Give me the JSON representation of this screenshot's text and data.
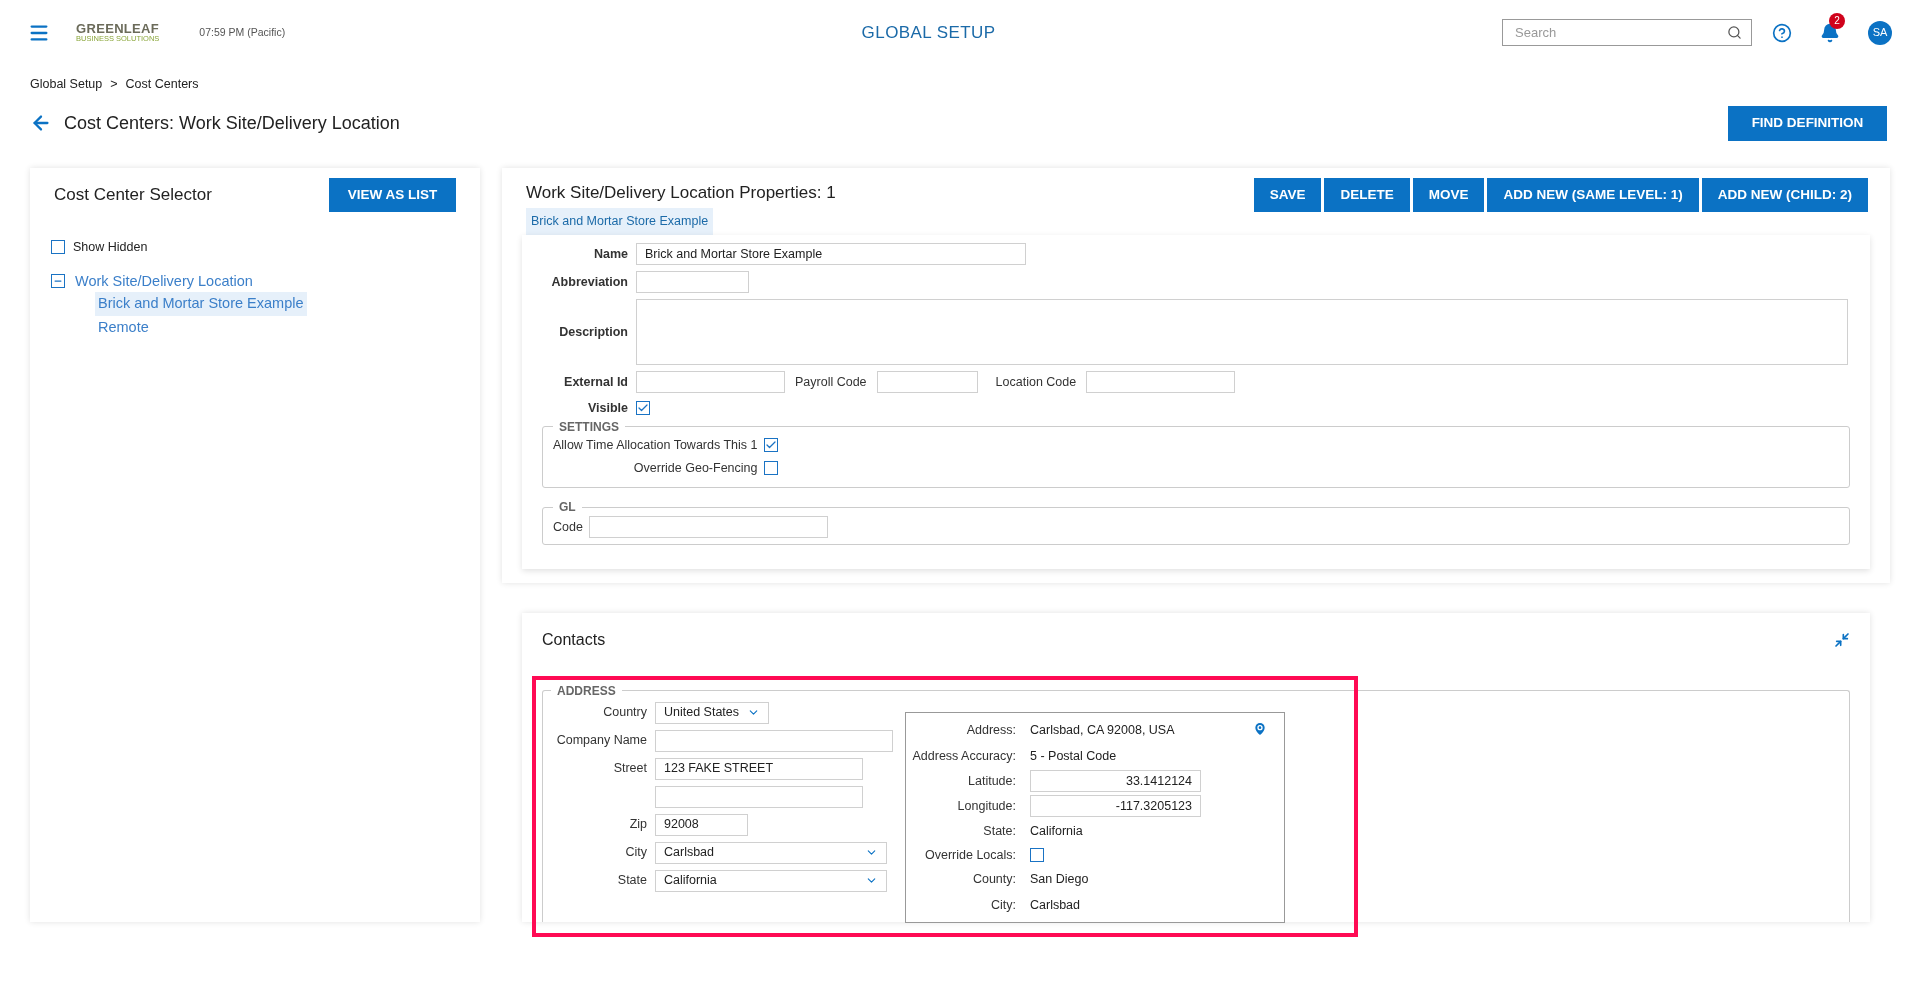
{
  "header": {
    "logo": {
      "name": "GREENLEAF",
      "tagline": "BUSINESS SOLUTIONS"
    },
    "time": "07:59 PM (Pacific)",
    "title": "GLOBAL SETUP",
    "search": {
      "placeholder": "Search"
    },
    "notifications": "2",
    "avatar": "SA"
  },
  "breadcrumb": {
    "items": [
      "Global Setup",
      "Cost Centers"
    ],
    "separator": ">"
  },
  "page_title": "Cost Centers: Work Site/Delivery Location",
  "find_button": "FIND DEFINITION",
  "selector": {
    "title": "Cost Center Selector",
    "view_button": "VIEW AS LIST",
    "show_hidden": {
      "label": "Show Hidden",
      "checked": false
    },
    "tree": [
      {
        "label": "Work Site/Delivery Location",
        "expanded": true,
        "selected": false,
        "children": [
          {
            "label": "Brick and Mortar Store Example",
            "selected": true
          },
          {
            "label": "Remote",
            "selected": false
          }
        ]
      }
    ]
  },
  "properties": {
    "title": "Work Site/Delivery Location Properties: 1",
    "tag": "Brick and Mortar Store Example",
    "buttons": [
      "SAVE",
      "DELETE",
      "MOVE",
      "ADD NEW (SAME LEVEL: 1)",
      "ADD NEW (CHILD: 2)"
    ],
    "name": {
      "label": "Name",
      "value": "Brick and Mortar Store Example"
    },
    "abbreviation": {
      "label": "Abbreviation"
    },
    "description": {
      "label": "Description"
    },
    "external_id": {
      "label": "External Id"
    },
    "payroll_code": {
      "label": "Payroll Code"
    },
    "location_code": {
      "label": "Location Code"
    },
    "visible": {
      "label": "Visible",
      "checked": true
    },
    "settings": {
      "legend": "SETTINGS",
      "options": [
        {
          "label": "Allow Time Allocation Towards This 1",
          "checked": true
        },
        {
          "label": "Override Geo-Fencing",
          "checked": false
        }
      ]
    },
    "gl": {
      "legend": "GL",
      "code_label": "Code"
    }
  },
  "contacts": {
    "title": "Contacts",
    "address": {
      "legend": "ADDRESS",
      "fields": [
        {
          "kind": "select",
          "label": "Country",
          "value": "United States"
        },
        {
          "kind": "input",
          "label": "Company Name"
        },
        {
          "kind": "input",
          "label": "Street",
          "value": "123 FAKE STREET"
        },
        {
          "kind": "input"
        },
        {
          "kind": "input",
          "label": "Zip",
          "value": "92008"
        },
        {
          "kind": "select",
          "label": "City",
          "value": "Carlsbad"
        },
        {
          "kind": "select",
          "label": "State",
          "value": "California"
        }
      ],
      "geo": [
        {
          "kind": "text",
          "label": "Address:",
          "value": "Carlsbad, CA 92008, USA"
        },
        {
          "kind": "text",
          "label": "Address Accuracy:",
          "value": "5 - Postal Code"
        },
        {
          "kind": "input",
          "label": "Latitude:",
          "value": "33.1412124"
        },
        {
          "kind": "input",
          "label": "Longitude:",
          "value": "-117.3205123"
        },
        {
          "kind": "text",
          "label": "State:",
          "value": "California"
        },
        {
          "kind": "checkbox",
          "label": "Override Locals:",
          "checked": false
        },
        {
          "kind": "text",
          "label": "County:",
          "value": "San Diego"
        },
        {
          "kind": "text",
          "label": "City:",
          "value": "Carlsbad"
        }
      ]
    }
  }
}
